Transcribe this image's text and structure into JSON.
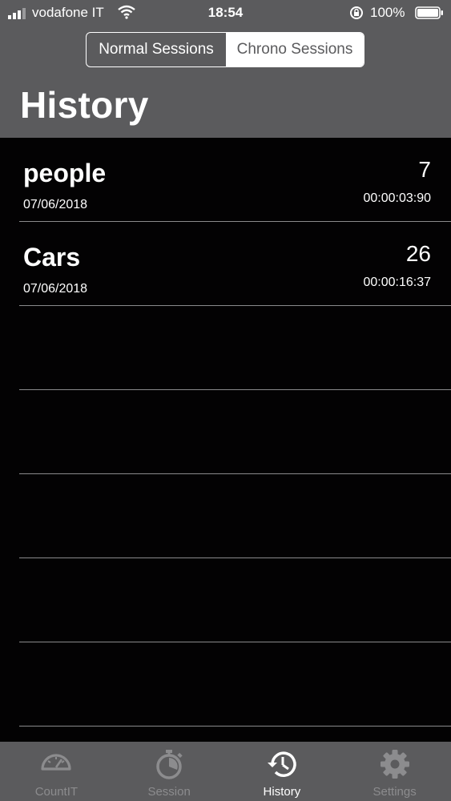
{
  "status_bar": {
    "carrier": "vodafone IT",
    "time": "18:54",
    "battery": "100%"
  },
  "segmented_control": {
    "options": [
      "Normal Sessions",
      "Chrono Sessions"
    ],
    "selected": "Chrono Sessions"
  },
  "page_title": "History",
  "sessions": [
    {
      "name": "people",
      "date": "07/06/2018",
      "count": "7",
      "duration": "00:00:03:90"
    },
    {
      "name": "Cars",
      "date": "07/06/2018",
      "count": "26",
      "duration": "00:00:16:37"
    }
  ],
  "tab_bar": {
    "tabs": [
      {
        "label": "CountIT",
        "icon": "gauge-icon",
        "active": false
      },
      {
        "label": "Session",
        "icon": "stopwatch-icon",
        "active": false
      },
      {
        "label": "History",
        "icon": "history-icon",
        "active": true
      },
      {
        "label": "Settings",
        "icon": "gear-icon",
        "active": false
      }
    ]
  },
  "colors": {
    "header_bg": "#5b5b5d",
    "list_bg": "#030203",
    "separator": "#8a8a8c",
    "inactive_tab": "#8c8c8e"
  }
}
